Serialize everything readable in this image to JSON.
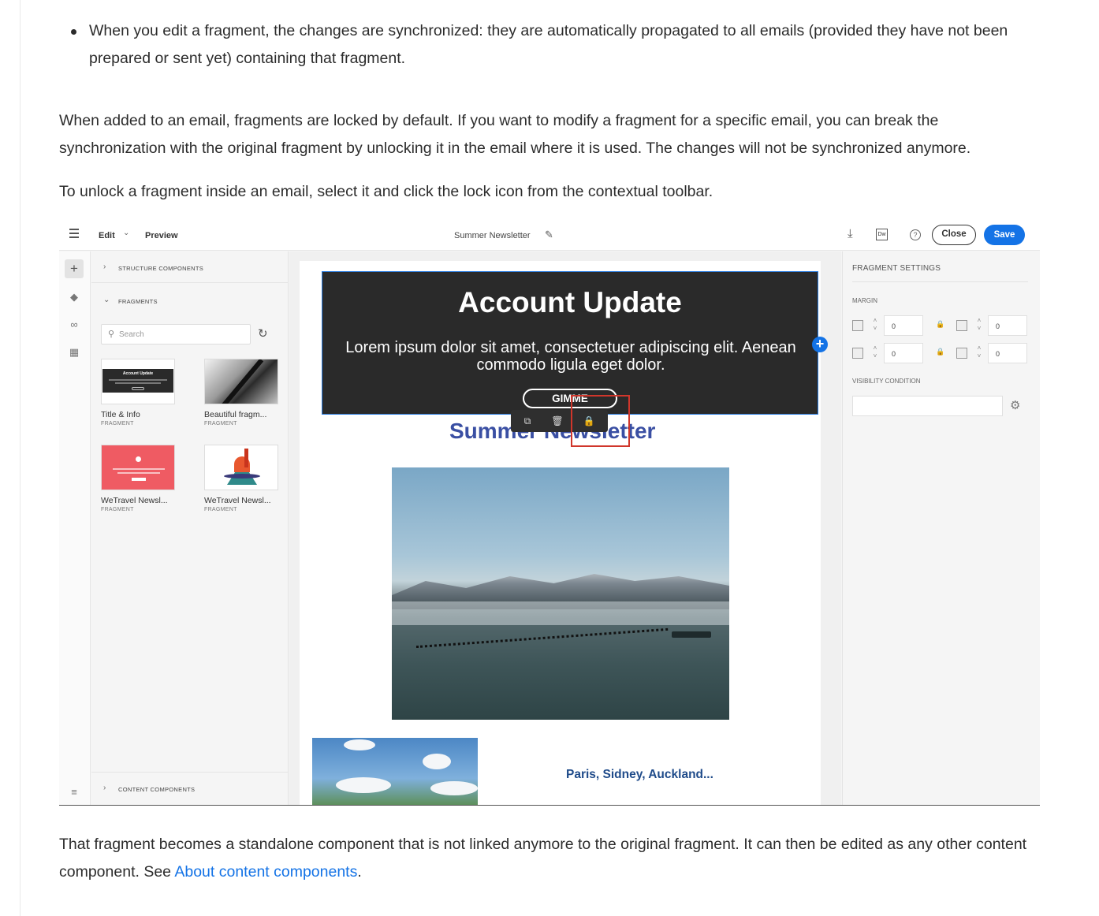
{
  "doc": {
    "bullet": "When you edit a fragment, the changes are synchronized: they are automatically propagated to all emails (provided they have not been prepared or sent yet) containing that fragment.",
    "para1": "When added to an email, fragments are locked by default. If you want to modify a fragment for a specific email, you can break the synchronization with the original fragment by unlocking it in the email where it is used. The changes will not be synchronized anymore.",
    "para2": "To unlock a fragment inside an email, select it and click the lock icon from the contextual toolbar.",
    "para3_before": "That fragment becomes a standalone component that is not linked anymore to the original fragment. It can then be edited as any other content component. See ",
    "para3_link": "About content components",
    "para3_after": "."
  },
  "editor": {
    "topbar": {
      "edit_label": "Edit",
      "preview_label": "Preview",
      "title": "Summer Newsletter",
      "dw_label": "Dw",
      "help_label": "?",
      "close_label": "Close",
      "save_label": "Save"
    },
    "left_panel": {
      "structure_label": "STRUCTURE COMPONENTS",
      "fragments_label": "FRAGMENTS",
      "search_placeholder": "Search",
      "content_label": "CONTENT COMPONENTS",
      "fragments": [
        {
          "name": "Title & Info",
          "type": "FRAGMENT",
          "thumb_title": "Account Update"
        },
        {
          "name": "Beautiful fragm...",
          "type": "FRAGMENT"
        },
        {
          "name": "WeTravel Newsl...",
          "type": "FRAGMENT"
        },
        {
          "name": "WeTravel Newsl...",
          "type": "FRAGMENT"
        }
      ]
    },
    "canvas": {
      "fragment_title": "Account Update",
      "fragment_body": "Lorem ipsum dolor sit amet, consectetuer adipiscing elit. Aenean commodo ligula eget dolor.",
      "fragment_button": "GIMME",
      "newsletter_title": "Summer Newsletter",
      "cities": "Paris, Sidney, Auckland..."
    },
    "right_panel": {
      "heading": "FRAGMENT SETTINGS",
      "margin_label": "MARGIN",
      "margin_values": [
        "0",
        "0",
        "0",
        "0"
      ],
      "visibility_label": "VISIBILITY CONDITION"
    }
  },
  "colors": {
    "accent": "#1473e6",
    "highlight_box": "#d0362b",
    "fragment_bg": "#2a2a2a",
    "newsletter_title": "#3a4fa3"
  }
}
